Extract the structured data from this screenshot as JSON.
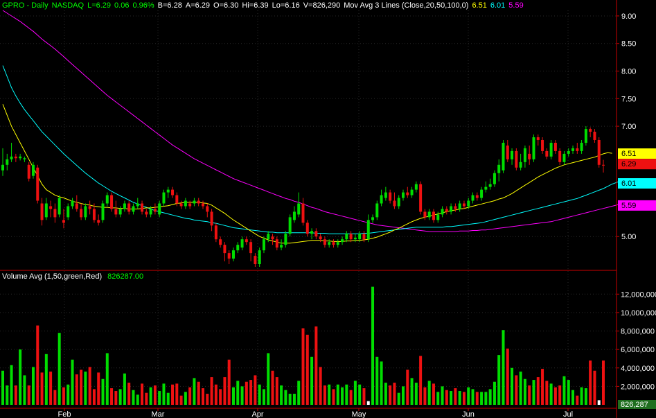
{
  "header": {
    "symbol": "GPRO - Daily",
    "exchange": "NASDAQ",
    "last": "L=6.29",
    "change": "0.06",
    "change_pct": "0.96%",
    "bid": "B=6.28",
    "ask": "A=6.29",
    "open": "O=6.30",
    "high": "Hi=6.39",
    "low": "Lo=6.16",
    "volume": "V=826,290",
    "ma_label": "Mov Avg 3 Lines (Close,20,50,100,0)",
    "ma20": "6.51",
    "ma50": "6.01",
    "ma100": "5.59"
  },
  "volume_header": {
    "label": "Volume Avg (1,50,green,Red)",
    "value": "826287.00"
  },
  "colors": {
    "up": "#00dd00",
    "down": "#ee1111",
    "ma20": "#ffff00",
    "ma50": "#00ffff",
    "ma100": "#ff00ff",
    "axis_line": "#cc0000",
    "tick_text": "#ffffff"
  },
  "chart_data": {
    "type": "candlestick",
    "x_labels": [
      "Feb",
      "Mar",
      "Apr",
      "May",
      "Jun",
      "Jul"
    ],
    "price_axis": {
      "ticks": [
        "9.00",
        "8.50",
        "8.00",
        "7.50",
        "7.00",
        "5.00"
      ],
      "tick_values": [
        9.0,
        8.5,
        8.0,
        7.5,
        7.0,
        5.0
      ],
      "range": [
        4.45,
        9.1
      ]
    },
    "price_tags": [
      {
        "label": "6.51",
        "value": 6.51,
        "color": "#ffff00",
        "text_color": "#000000"
      },
      {
        "label": "6.29",
        "value": 6.32,
        "color": "#ee1111",
        "text_color": "#000000"
      },
      {
        "label": "6.01",
        "value": 5.97,
        "color": "#00ffff",
        "text_color": "#000000"
      },
      {
        "label": "5.59",
        "value": 5.57,
        "color": "#ff00ff",
        "text_color": "#000000"
      }
    ],
    "volume_axis": {
      "ticks": [
        "12,000,000",
        "10,000,000",
        "8,000,000",
        "6,000,000",
        "4,000,000",
        "2,000,000"
      ],
      "tick_values": [
        12000000,
        10000000,
        8000000,
        6000000,
        4000000,
        2000000
      ],
      "range": [
        0,
        13600000
      ],
      "last_tag": "826,287"
    },
    "candles": [
      [
        6.2,
        6.3,
        6.6,
        6.1
      ],
      [
        6.3,
        6.4,
        6.5,
        6.2
      ],
      [
        6.4,
        6.45,
        6.7,
        6.35
      ],
      [
        6.45,
        6.42,
        6.5,
        6.35
      ],
      [
        6.42,
        6.45,
        6.5,
        6.38
      ],
      [
        6.4,
        6.42,
        6.45,
        6.35
      ],
      [
        6.3,
        6.05,
        6.35,
        6.0
      ],
      [
        6.1,
        6.3,
        6.35,
        6.05
      ],
      [
        6.25,
        5.65,
        6.3,
        5.6
      ],
      [
        5.6,
        5.3,
        5.7,
        5.2
      ],
      [
        5.35,
        5.6,
        5.7,
        5.3
      ],
      [
        5.55,
        5.5,
        5.65,
        5.35
      ],
      [
        5.5,
        5.35,
        5.6,
        5.25
      ],
      [
        5.4,
        5.7,
        5.75,
        5.35
      ],
      [
        5.3,
        5.25,
        5.5,
        5.15
      ],
      [
        5.35,
        5.55,
        5.6,
        5.3
      ],
      [
        5.55,
        5.65,
        5.7,
        5.5
      ],
      [
        5.6,
        5.5,
        5.75,
        5.45
      ],
      [
        5.5,
        5.35,
        5.6,
        5.3
      ],
      [
        5.35,
        5.55,
        5.6,
        5.3
      ],
      [
        5.55,
        5.5,
        5.65,
        5.4
      ],
      [
        5.5,
        5.3,
        5.6,
        5.25
      ],
      [
        5.3,
        5.25,
        5.4,
        5.2
      ],
      [
        5.3,
        5.6,
        5.65,
        5.25
      ],
      [
        5.6,
        5.75,
        5.8,
        5.55
      ],
      [
        5.75,
        5.5,
        5.8,
        5.45
      ],
      [
        5.5,
        5.4,
        5.65,
        5.35
      ],
      [
        5.4,
        5.5,
        5.55,
        5.35
      ],
      [
        5.5,
        5.6,
        5.65,
        5.45
      ],
      [
        5.6,
        5.45,
        5.65,
        5.4
      ],
      [
        5.45,
        5.55,
        5.6,
        5.4
      ],
      [
        5.55,
        5.6,
        5.7,
        5.5
      ],
      [
        5.6,
        5.45,
        5.65,
        5.4
      ],
      [
        5.45,
        5.4,
        5.5,
        5.35
      ],
      [
        5.4,
        5.5,
        5.55,
        5.35
      ],
      [
        5.5,
        5.45,
        5.6,
        5.4
      ],
      [
        5.4,
        5.6,
        5.65,
        5.35
      ],
      [
        5.6,
        5.8,
        5.85,
        5.55
      ],
      [
        5.8,
        5.85,
        5.9,
        5.7
      ],
      [
        5.85,
        5.75,
        5.9,
        5.7
      ],
      [
        5.75,
        5.6,
        5.8,
        5.55
      ],
      [
        5.6,
        5.55,
        5.65,
        5.5
      ],
      [
        5.55,
        5.65,
        5.7,
        5.5
      ],
      [
        5.6,
        5.55,
        5.65,
        5.5
      ],
      [
        5.6,
        5.65,
        5.7,
        5.55
      ],
      [
        5.65,
        5.6,
        5.7,
        5.55
      ],
      [
        5.6,
        5.55,
        5.65,
        5.5
      ],
      [
        5.55,
        5.45,
        5.6,
        5.35
      ],
      [
        5.45,
        5.2,
        5.5,
        5.1
      ],
      [
        5.2,
        4.95,
        5.25,
        4.9
      ],
      [
        4.95,
        4.85,
        5.0,
        4.8
      ],
      [
        4.85,
        4.7,
        4.9,
        4.55
      ],
      [
        4.7,
        4.6,
        4.75,
        4.5
      ],
      [
        4.6,
        4.75,
        4.8,
        4.55
      ],
      [
        4.75,
        4.85,
        4.9,
        4.7
      ],
      [
        4.8,
        4.95,
        5.0,
        4.75
      ],
      [
        4.95,
        4.9,
        5.0,
        4.85
      ],
      [
        4.9,
        4.7,
        4.95,
        4.55
      ],
      [
        4.65,
        4.5,
        4.7,
        4.45
      ],
      [
        4.5,
        4.75,
        4.8,
        4.45
      ],
      [
        4.75,
        4.95,
        5.0,
        4.7
      ],
      [
        4.95,
        5.05,
        5.1,
        4.9
      ],
      [
        5.0,
        4.95,
        5.05,
        4.85
      ],
      [
        4.95,
        4.8,
        5.0,
        4.75
      ],
      [
        4.8,
        4.85,
        4.95,
        4.75
      ],
      [
        4.85,
        5.05,
        5.1,
        4.8
      ],
      [
        5.05,
        5.35,
        5.4,
        5.0
      ],
      [
        5.3,
        5.45,
        5.55,
        5.25
      ],
      [
        5.4,
        5.6,
        5.8,
        5.35
      ],
      [
        5.6,
        5.25,
        5.7,
        5.2
      ],
      [
        5.25,
        5.05,
        5.3,
        5.0
      ],
      [
        5.05,
        5.1,
        5.15,
        4.95
      ],
      [
        5.1,
        5.0,
        5.15,
        4.95
      ],
      [
        5.0,
        4.95,
        5.05,
        4.9
      ],
      [
        4.95,
        4.85,
        5.0,
        4.8
      ],
      [
        4.85,
        4.9,
        4.95,
        4.8
      ],
      [
        4.9,
        4.85,
        4.95,
        4.8
      ],
      [
        4.85,
        4.9,
        4.95,
        4.8
      ],
      [
        4.9,
        4.95,
        5.0,
        4.85
      ],
      [
        4.95,
        5.05,
        5.1,
        4.9
      ],
      [
        5.05,
        4.95,
        5.1,
        4.9
      ],
      [
        4.95,
        4.98,
        5.05,
        4.9
      ],
      [
        4.95,
        5.05,
        5.1,
        4.9
      ],
      [
        5.05,
        4.95,
        5.1,
        4.9
      ],
      [
        4.95,
        5.3,
        5.4,
        4.9
      ],
      [
        5.3,
        5.35,
        5.4,
        5.25
      ],
      [
        5.35,
        5.6,
        5.65,
        5.3
      ],
      [
        5.6,
        5.75,
        5.85,
        5.55
      ],
      [
        5.7,
        5.8,
        5.9,
        5.65
      ],
      [
        5.8,
        5.65,
        5.85,
        5.6
      ],
      [
        5.65,
        5.55,
        5.8,
        5.5
      ],
      [
        5.55,
        5.7,
        5.75,
        5.5
      ],
      [
        5.7,
        5.8,
        5.85,
        5.65
      ],
      [
        5.8,
        5.75,
        5.9,
        5.7
      ],
      [
        5.75,
        5.85,
        5.9,
        5.7
      ],
      [
        5.85,
        5.95,
        6.0,
        5.8
      ],
      [
        5.95,
        5.45,
        6.0,
        5.4
      ],
      [
        5.45,
        5.35,
        5.5,
        5.3
      ],
      [
        5.35,
        5.45,
        5.5,
        5.3
      ],
      [
        5.45,
        5.3,
        5.5,
        5.25
      ],
      [
        5.3,
        5.4,
        5.45,
        5.25
      ],
      [
        5.4,
        5.5,
        5.55,
        5.35
      ],
      [
        5.5,
        5.45,
        5.55,
        5.4
      ],
      [
        5.45,
        5.55,
        5.6,
        5.4
      ],
      [
        5.55,
        5.5,
        5.6,
        5.45
      ],
      [
        5.5,
        5.6,
        5.65,
        5.45
      ],
      [
        5.6,
        5.55,
        5.65,
        5.5
      ],
      [
        5.55,
        5.65,
        5.7,
        5.5
      ],
      [
        5.65,
        5.75,
        5.8,
        5.6
      ],
      [
        5.75,
        5.7,
        5.8,
        5.65
      ],
      [
        5.7,
        5.85,
        5.9,
        5.65
      ],
      [
        5.85,
        5.9,
        6.0,
        5.8
      ],
      [
        5.9,
        5.95,
        6.05,
        5.85
      ],
      [
        5.95,
        6.15,
        6.2,
        5.9
      ],
      [
        6.15,
        6.3,
        6.4,
        6.0
      ],
      [
        6.2,
        6.7,
        6.75,
        6.15
      ],
      [
        6.65,
        6.4,
        6.75,
        6.35
      ],
      [
        6.4,
        6.55,
        6.6,
        6.3
      ],
      [
        6.55,
        6.25,
        6.6,
        6.2
      ],
      [
        6.25,
        6.35,
        6.5,
        6.2
      ],
      [
        6.35,
        6.6,
        6.65,
        6.25
      ],
      [
        6.5,
        6.4,
        6.65,
        6.3
      ],
      [
        6.4,
        6.8,
        6.85,
        6.35
      ],
      [
        6.8,
        6.75,
        6.85,
        6.65
      ],
      [
        6.75,
        6.55,
        6.8,
        6.5
      ],
      [
        6.55,
        6.45,
        6.6,
        6.4
      ],
      [
        6.45,
        6.7,
        6.75,
        6.4
      ],
      [
        6.7,
        6.55,
        6.75,
        6.5
      ],
      [
        6.55,
        6.35,
        6.6,
        6.3
      ],
      [
        6.35,
        6.5,
        6.55,
        6.3
      ],
      [
        6.5,
        6.55,
        6.6,
        6.45
      ],
      [
        6.55,
        6.6,
        6.65,
        6.5
      ],
      [
        6.6,
        6.55,
        6.7,
        6.5
      ],
      [
        6.55,
        6.7,
        6.75,
        6.5
      ],
      [
        6.7,
        6.95,
        7.0,
        6.65
      ],
      [
        6.95,
        6.9,
        6.98,
        6.8
      ],
      [
        6.9,
        6.75,
        6.95,
        6.7
      ],
      [
        6.75,
        6.3,
        6.8,
        6.25
      ],
      [
        6.3,
        6.29,
        6.39,
        6.16
      ]
    ],
    "volume_millions": [
      3.7,
      2.1,
      4.3,
      2.1,
      6.0,
      3.2,
      2.1,
      4.1,
      8.6,
      3.5,
      5.5,
      3.6,
      1.6,
      7.8,
      1.9,
      2.2,
      4.9,
      3.3,
      3.8,
      3.6,
      4.1,
      1.7,
      3.5,
      2.8,
      5.6,
      1.8,
      1.5,
      1.7,
      3.4,
      2.4,
      1.6,
      1.1,
      2.3,
      1.3,
      1.9,
      2.1,
      1.5,
      2.3,
      1.3,
      2.2,
      2.3,
      1.0,
      1.4,
      1.9,
      2.9,
      2.5,
      1.8,
      1.2,
      3.0,
      2.2,
      1.7,
      3.0,
      4.9,
      1.9,
      2.6,
      2.0,
      2.5,
      2.7,
      3.2,
      2.2,
      1.7,
      5.6,
      3.7,
      3.0,
      2.1,
      1.6,
      1.2,
      1.2,
      2.6,
      8.3,
      7.6,
      5.2,
      8.5,
      4.1,
      2.1,
      2.2,
      1.7,
      2.2,
      1.9,
      2.2,
      1.6,
      2.6,
      2.2,
      1.8,
      0.4,
      12.8,
      5.2,
      4.7,
      2.4,
      2.1,
      2.4,
      1.3,
      2.0,
      3.8,
      2.9,
      2.4,
      5.3,
      1.9,
      2.6,
      2.3,
      1.4,
      2.0,
      1.6,
      1.5,
      1.8,
      1.5,
      1.4,
      1.9,
      1.7,
      1.4,
      1.4,
      1.4,
      1.7,
      2.5,
      5.4,
      8.1,
      6.1,
      4.0,
      3.2,
      3.6,
      2.8,
      2.1,
      2.7,
      3.0,
      3.9,
      2.6,
      2.3,
      1.9,
      2.1,
      3.1,
      2.7,
      1.6,
      1.0,
      1.9,
      1.8,
      4.8,
      3.7,
      0.5,
      4.8
    ],
    "ma20": [
      7.4,
      7.2,
      7.0,
      6.85,
      6.7,
      6.55,
      6.4,
      6.25,
      6.1,
      5.95,
      5.85,
      5.8,
      5.75,
      5.72,
      5.7,
      5.67,
      5.64,
      5.62,
      5.6,
      5.58,
      5.57,
      5.55,
      5.54,
      5.53,
      5.53,
      5.52,
      5.52,
      5.51,
      5.51,
      5.5,
      5.5,
      5.5,
      5.51,
      5.52,
      5.52,
      5.53,
      5.54,
      5.55,
      5.56,
      5.58,
      5.6,
      5.61,
      5.62,
      5.62,
      5.62,
      5.62,
      5.61,
      5.6,
      5.57,
      5.52,
      5.47,
      5.42,
      5.36,
      5.3,
      5.25,
      5.2,
      5.15,
      5.1,
      5.05,
      5.0,
      4.97,
      4.94,
      4.92,
      4.9,
      4.88,
      4.88,
      4.88,
      4.89,
      4.9,
      4.91,
      4.92,
      4.93,
      4.93,
      4.93,
      4.92,
      4.92,
      4.91,
      4.91,
      4.91,
      4.92,
      4.92,
      4.93,
      4.93,
      4.94,
      4.95,
      4.97,
      4.99,
      5.02,
      5.05,
      5.08,
      5.12,
      5.15,
      5.19,
      5.23,
      5.27,
      5.3,
      5.33,
      5.35,
      5.37,
      5.39,
      5.41,
      5.43,
      5.45,
      5.47,
      5.48,
      5.5,
      5.51,
      5.53,
      5.55,
      5.57,
      5.59,
      5.61,
      5.63,
      5.65,
      5.68,
      5.7,
      5.74,
      5.78,
      5.83,
      5.88,
      5.93,
      5.98,
      6.03,
      6.08,
      6.12,
      6.16,
      6.2,
      6.24,
      6.27,
      6.3,
      6.32,
      6.34,
      6.36,
      6.38,
      6.4,
      6.42,
      6.44,
      6.47,
      6.5,
      6.52,
      6.51
    ],
    "ma50": [
      8.1,
      7.9,
      7.7,
      7.55,
      7.42,
      7.3,
      7.2,
      7.1,
      7.0,
      6.9,
      6.82,
      6.74,
      6.66,
      6.58,
      6.5,
      6.43,
      6.36,
      6.29,
      6.22,
      6.15,
      6.09,
      6.03,
      5.97,
      5.92,
      5.87,
      5.82,
      5.78,
      5.74,
      5.7,
      5.66,
      5.62,
      5.59,
      5.56,
      5.53,
      5.5,
      5.47,
      5.45,
      5.43,
      5.41,
      5.39,
      5.37,
      5.35,
      5.33,
      5.32,
      5.3,
      5.29,
      5.28,
      5.27,
      5.25,
      5.24,
      5.22,
      5.2,
      5.18,
      5.16,
      5.15,
      5.14,
      5.13,
      5.12,
      5.11,
      5.1,
      5.09,
      5.08,
      5.08,
      5.07,
      5.07,
      5.07,
      5.07,
      5.07,
      5.07,
      5.07,
      5.07,
      5.07,
      5.06,
      5.06,
      5.06,
      5.05,
      5.05,
      5.05,
      5.05,
      5.05,
      5.05,
      5.05,
      5.05,
      5.06,
      5.06,
      5.07,
      5.08,
      5.09,
      5.1,
      5.11,
      5.12,
      5.13,
      5.14,
      5.15,
      5.16,
      5.17,
      5.17,
      5.17,
      5.17,
      5.17,
      5.17,
      5.17,
      5.18,
      5.18,
      5.19,
      5.2,
      5.21,
      5.22,
      5.23,
      5.24,
      5.25,
      5.27,
      5.29,
      5.31,
      5.33,
      5.35,
      5.37,
      5.39,
      5.41,
      5.43,
      5.45,
      5.47,
      5.49,
      5.51,
      5.53,
      5.55,
      5.57,
      5.59,
      5.61,
      5.63,
      5.65,
      5.67,
      5.69,
      5.72,
      5.75,
      5.78,
      5.81,
      5.84,
      5.87,
      5.91,
      5.95,
      5.98,
      6.01
    ],
    "ma100": [
      9.1,
      9.05,
      9.0,
      8.95,
      8.9,
      8.84,
      8.78,
      8.72,
      8.65,
      8.58,
      8.52,
      8.46,
      8.4,
      8.33,
      8.26,
      8.19,
      8.12,
      8.05,
      7.98,
      7.91,
      7.84,
      7.77,
      7.7,
      7.63,
      7.56,
      7.5,
      7.44,
      7.38,
      7.32,
      7.26,
      7.2,
      7.14,
      7.08,
      7.02,
      6.96,
      6.9,
      6.84,
      6.78,
      6.72,
      6.66,
      6.61,
      6.56,
      6.51,
      6.46,
      6.41,
      6.37,
      6.33,
      6.29,
      6.25,
      6.21,
      6.17,
      6.13,
      6.09,
      6.05,
      6.02,
      5.99,
      5.96,
      5.93,
      5.9,
      5.87,
      5.84,
      5.81,
      5.78,
      5.75,
      5.72,
      5.69,
      5.67,
      5.64,
      5.62,
      5.59,
      5.56,
      5.53,
      5.51,
      5.48,
      5.45,
      5.43,
      5.41,
      5.39,
      5.37,
      5.35,
      5.33,
      5.31,
      5.29,
      5.27,
      5.25,
      5.23,
      5.21,
      5.2,
      5.19,
      5.18,
      5.17,
      5.16,
      5.15,
      5.14,
      5.13,
      5.12,
      5.11,
      5.1,
      5.09,
      5.09,
      5.09,
      5.09,
      5.09,
      5.09,
      5.09,
      5.1,
      5.1,
      5.1,
      5.11,
      5.11,
      5.12,
      5.12,
      5.13,
      5.14,
      5.15,
      5.16,
      5.17,
      5.18,
      5.19,
      5.2,
      5.21,
      5.22,
      5.23,
      5.24,
      5.25,
      5.26,
      5.27,
      5.29,
      5.31,
      5.33,
      5.35,
      5.37,
      5.39,
      5.41,
      5.43,
      5.45,
      5.47,
      5.49,
      5.51,
      5.53,
      5.55,
      5.57,
      5.59
    ]
  }
}
